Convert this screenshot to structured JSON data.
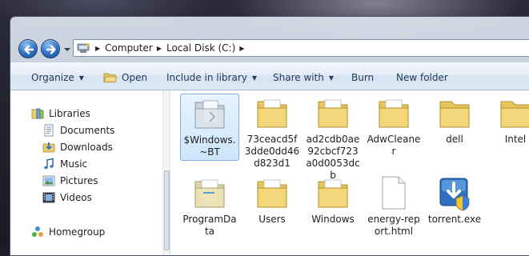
{
  "address": {
    "crumbs": [
      "Computer",
      "Local Disk (C:)"
    ]
  },
  "toolbar": {
    "organize": "Organize",
    "open": "Open",
    "include": "Include in library",
    "share": "Share with",
    "burn": "Burn",
    "new_folder": "New folder"
  },
  "nav_pane": {
    "libraries": "Libraries",
    "documents": "Documents",
    "downloads": "Downloads",
    "music": "Music",
    "pictures": "Pictures",
    "videos": "Videos",
    "homegroup": "Homegroup"
  },
  "files": [
    {
      "name": "$Windows.~BT",
      "type": "folder",
      "selected": true
    },
    {
      "name": "73ceacd5f3dde0dd46d823d1",
      "type": "folder"
    },
    {
      "name": "ad2cdb0ae92cbcf723a0d0053dcb",
      "type": "folder"
    },
    {
      "name": "AdwCleaner",
      "type": "folder"
    },
    {
      "name": "dell",
      "type": "folder"
    },
    {
      "name": "Intel",
      "type": "folder"
    },
    {
      "name": "ProgramData",
      "type": "folder"
    },
    {
      "name": "Users",
      "type": "folder"
    },
    {
      "name": "Windows",
      "type": "folder"
    },
    {
      "name": "energy-report.html",
      "type": "html-file"
    },
    {
      "name": "torrent.exe",
      "type": "exe-file"
    }
  ],
  "colors": {
    "folder_yellow": "#f3d77a",
    "selection_border": "#84acdd",
    "toolbar_text": "#1e395b"
  }
}
